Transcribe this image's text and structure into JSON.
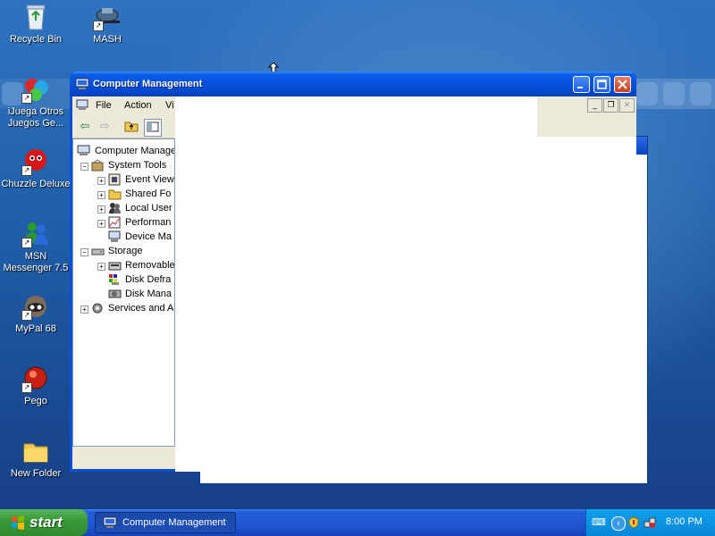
{
  "desktop": {
    "icons": [
      {
        "label": "Recycle Bin",
        "icon": "recycle-bin-icon"
      },
      {
        "label": "MASH",
        "icon": "mash-icon"
      },
      {
        "label": "iJuega Otros Juegos Ge...",
        "icon": "game-shortcut-icon"
      },
      {
        "label": "Chuzzle Deluxe",
        "icon": "chuzzle-icon"
      },
      {
        "label": "MSN Messenger 7.5",
        "icon": "msn-messenger-icon"
      },
      {
        "label": "MyPal 68",
        "icon": "mypal-icon"
      },
      {
        "label": "Pego",
        "icon": "pego-icon"
      },
      {
        "label": "New Folder",
        "icon": "folder-icon"
      }
    ]
  },
  "window": {
    "title": "Computer Management",
    "menu": [
      "File",
      "Action",
      "Vi"
    ],
    "tree": [
      {
        "label": "Computer Manage",
        "level": 0,
        "expander": "",
        "icon": "computer-icon"
      },
      {
        "label": "System Tools",
        "level": 1,
        "expander": "−",
        "icon": "tools-icon"
      },
      {
        "label": "Event View",
        "level": 2,
        "expander": "+",
        "icon": "event-viewer-icon"
      },
      {
        "label": "Shared Fo",
        "level": 2,
        "expander": "+",
        "icon": "shared-folder-icon"
      },
      {
        "label": "Local User",
        "level": 2,
        "expander": "+",
        "icon": "users-icon"
      },
      {
        "label": "Performan",
        "level": 2,
        "expander": "+",
        "icon": "performance-icon"
      },
      {
        "label": "Device Ma",
        "level": 2,
        "expander": "",
        "icon": "device-manager-icon"
      },
      {
        "label": "Storage",
        "level": 1,
        "expander": "−",
        "icon": "storage-icon"
      },
      {
        "label": "Removable",
        "level": 2,
        "expander": "+",
        "icon": "removable-storage-icon"
      },
      {
        "label": "Disk Defra",
        "level": 2,
        "expander": "",
        "icon": "defrag-icon"
      },
      {
        "label": "Disk Mana",
        "level": 2,
        "expander": "",
        "icon": "disk-management-icon"
      },
      {
        "label": "Services and A",
        "level": 1,
        "expander": "+",
        "icon": "services-icon"
      }
    ]
  },
  "taskbar": {
    "start_label": "start",
    "task_label": "Computer Management",
    "clock": "8:00 PM"
  }
}
